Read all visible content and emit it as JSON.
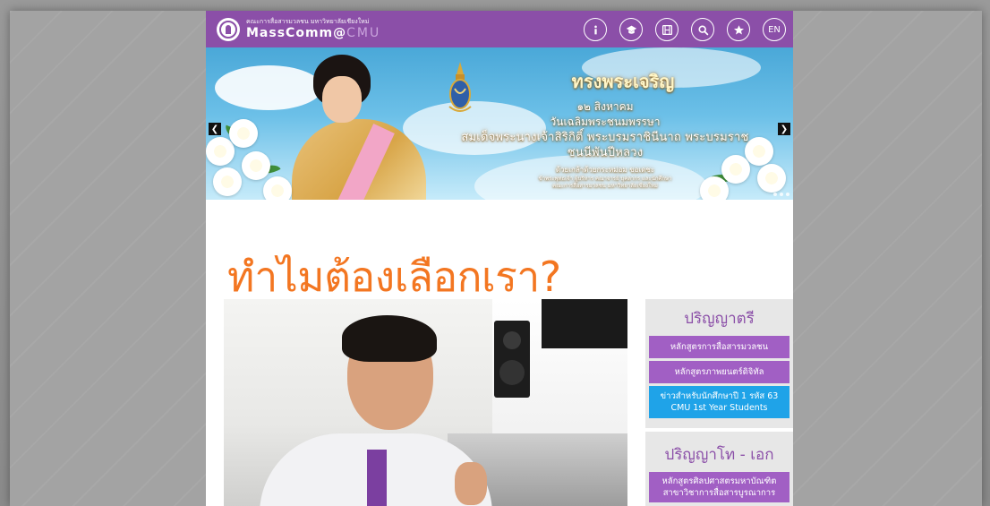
{
  "header": {
    "brand_sub": "คณะการสื่อสารมวลชน มหาวิทยาลัยเชียงใหม่",
    "brand_main": "MassComm@",
    "brand_cmu": "CMU",
    "lang_label": "EN"
  },
  "nav_icons": [
    "info-icon",
    "graduation-cap-icon",
    "film-icon",
    "search-icon",
    "star-icon"
  ],
  "banner": {
    "title": "ทรงพระเจริญ",
    "line1": "๑๒ สิงหาคม",
    "line2": "วันเฉลิมพระชนมพรรษา",
    "line3": "สมเด็จพระนางเจ้าสิริกิติ์ พระบรมราชินีนาถ พระบรมราชชนนีพันปีหลวง",
    "line4": "ด้วยเกล้าด้วยกระหม่อม ขอเดชะ",
    "line5": "ข้าพระพุทธเจ้า ผู้บริหาร คณาจารย์ บุคลากร และนักศึกษา",
    "line6": "คณะการสื่อสารมวลชน มหาวิทยาลัยเชียงใหม่"
  },
  "main": {
    "why_title": "ทำไมต้องเลือกเรา?"
  },
  "sidebar": {
    "bachelor_heading": "ปริญญาตรี",
    "bachelor_items": [
      "หลักสูตรการสื่อสารมวลชน",
      "หลักสูตรภาพยนตร์ดิจิทัล"
    ],
    "news_line1": "ข่าวสำหรับนักศึกษาปี 1 รหัส 63",
    "news_line2": "CMU 1st Year Students",
    "master_heading": "ปริญญาโท - เอก",
    "master_line1": "หลักสูตรศิลปศาสตรมหาบัณฑิต",
    "master_line2": "สาขาวิชาการสื่อสารบูรณาการ"
  },
  "colors": {
    "header_purple": "#8b4fa8",
    "title_orange": "#f37621",
    "sidebar_button": "#a15fc4",
    "news_blue": "#1fa3e8"
  }
}
